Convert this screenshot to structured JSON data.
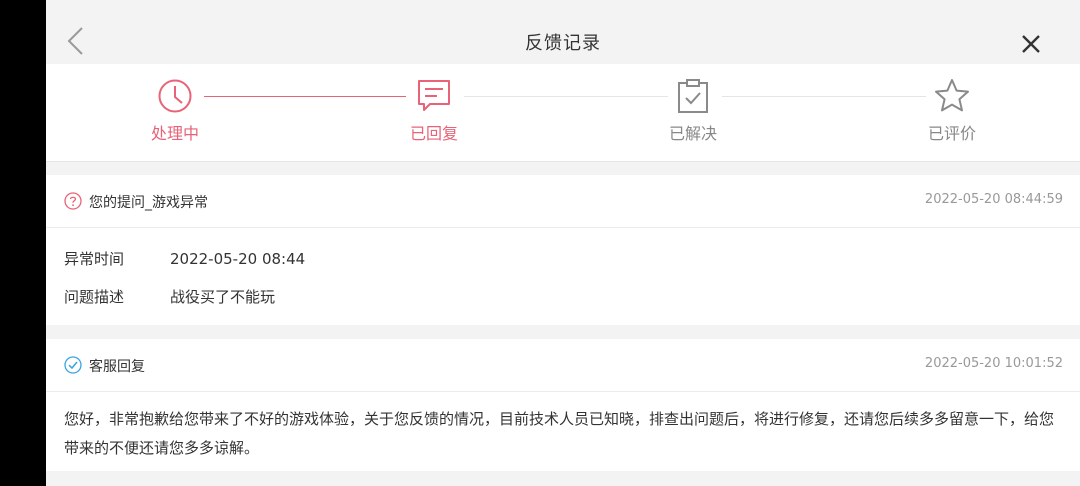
{
  "header": {
    "title": "反馈记录",
    "back_icon": "chevron-left-icon",
    "close_icon": "close-icon"
  },
  "progress": {
    "accent_color": "#e86378",
    "steps": [
      {
        "label": "处理中",
        "icon": "clock-icon",
        "state": "active"
      },
      {
        "label": "已回复",
        "icon": "chat-icon",
        "state": "active"
      },
      {
        "label": "已解决",
        "icon": "clipboard-check-icon",
        "state": "inactive"
      },
      {
        "label": "已评价",
        "icon": "star-icon",
        "state": "inactive"
      }
    ]
  },
  "question": {
    "title": "您的提问_游戏异常",
    "icon": "question-circle-icon",
    "timestamp": "2022-05-20 08:44:59",
    "fields": [
      {
        "key": "异常时间",
        "value": "2022-05-20 08:44"
      },
      {
        "key": "问题描述",
        "value": "战役买了不能玩"
      }
    ]
  },
  "reply": {
    "title": "客服回复",
    "icon": "check-circle-icon",
    "timestamp": "2022-05-20 10:01:52",
    "content": "您好，非常抱歉给您带来了不好的游戏体验，关于您反馈的情况，目前技术人员已知晓，排查出问题后，将进行修复，还请您后续多多留意一下，给您带来的不便还请您多多谅解。"
  }
}
